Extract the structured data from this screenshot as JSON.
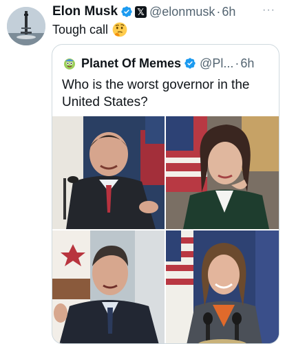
{
  "tweet": {
    "author_name": "Elon Musk",
    "handle": "@elonmusk",
    "separator": "·",
    "time": "6h",
    "text": "Tough call",
    "emoji": "thinking-face-icon",
    "more": "···"
  },
  "quote": {
    "author_name": "Planet Of Memes",
    "handle": "@Pl...",
    "separator": "·",
    "time": "6h",
    "text": "Who is the worst governor in the United States?",
    "images": [
      "governor-photo-1",
      "governor-photo-2",
      "governor-photo-3",
      "governor-photo-4"
    ]
  },
  "colors": {
    "verified_blue": "#1d9bf0",
    "text_primary": "#0f1419",
    "text_secondary": "#536471",
    "border": "#cfd9de"
  }
}
